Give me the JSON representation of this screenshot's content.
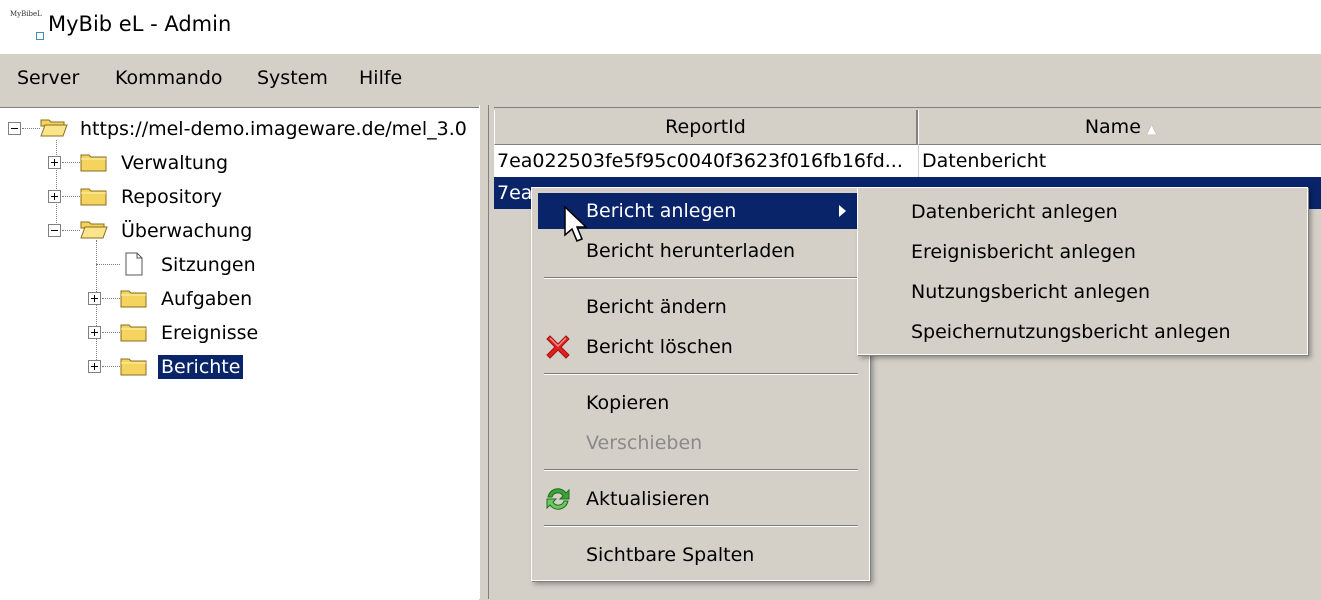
{
  "window": {
    "title": "MyBib eL - Admin",
    "icon": "mybib-el-logo-icon",
    "icon_text": "MyBibeL"
  },
  "menubar": {
    "items": [
      {
        "label": "Server"
      },
      {
        "label": "Kommando"
      },
      {
        "label": "System"
      },
      {
        "label": "Hilfe"
      }
    ]
  },
  "tree": {
    "root": {
      "label": "https://mel-demo.imageware.de/mel_3.0",
      "icon": "folder-open-icon"
    },
    "nodes": [
      {
        "label": "Verwaltung",
        "icon": "folder-icon",
        "expander": "plus"
      },
      {
        "label": "Repository",
        "icon": "folder-icon",
        "expander": "plus"
      },
      {
        "label": "Überwachung",
        "icon": "folder-open-icon",
        "expander": "minus"
      },
      {
        "label": "Sitzungen",
        "icon": "document-icon",
        "expander": "none"
      },
      {
        "label": "Aufgaben",
        "icon": "folder-icon",
        "expander": "plus"
      },
      {
        "label": "Ereignisse",
        "icon": "folder-icon",
        "expander": "plus"
      },
      {
        "label": "Berichte",
        "icon": "folder-icon",
        "expander": "plus",
        "selected": true
      }
    ]
  },
  "table": {
    "columns": [
      {
        "label": "ReportId"
      },
      {
        "label": "Name",
        "sort": "ascending"
      }
    ],
    "rows": [
      {
        "report_id": "7ea022503fe5f95c0040f3623f016fb16fd...",
        "name": "Datenbericht"
      },
      {
        "report_id": "7ea",
        "name": "",
        "selected": true
      }
    ]
  },
  "context_menu": {
    "items": [
      {
        "label": "Bericht anlegen",
        "submenu": true,
        "highlighted": true
      },
      {
        "label": "Bericht herunterladen"
      },
      {
        "label": "Bericht ändern"
      },
      {
        "label": "Bericht löschen",
        "icon": "delete-x-icon"
      },
      {
        "label": "Kopieren"
      },
      {
        "label": "Verschieben",
        "disabled": true
      },
      {
        "label": "Aktualisieren",
        "icon": "refresh-icon"
      },
      {
        "label": "Sichtbare Spalten"
      }
    ]
  },
  "submenu": {
    "items": [
      {
        "label": "Datenbericht anlegen"
      },
      {
        "label": "Ereignisbericht anlegen"
      },
      {
        "label": "Nutzungsbericht anlegen"
      },
      {
        "label": "Speichernutzungsbericht anlegen"
      }
    ]
  },
  "colors": {
    "selection": "#0a246a",
    "chrome": "#d4d0c8",
    "folder": "#f4d35e",
    "delete_icon": "#e02020",
    "refresh_icon": "#3aa335"
  }
}
